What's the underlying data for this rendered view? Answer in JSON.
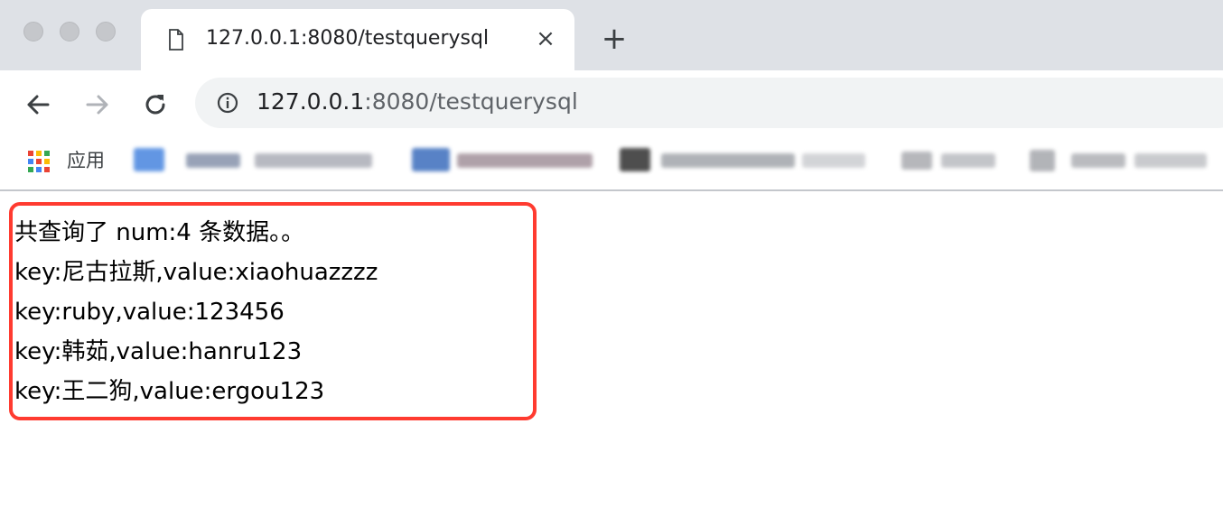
{
  "browser": {
    "tab": {
      "title": "127.0.0.1:8080/testquerysql",
      "close_label": "×"
    },
    "new_tab_label": "+",
    "address_bar": {
      "host": "127.0.0.1",
      "rest": ":8080/testquerysql"
    },
    "bookmarks": {
      "apps_label": "应用"
    }
  },
  "page": {
    "lines": [
      "共查询了 num:4 条数据。。",
      "key:尼古拉斯,value:xiaohuazzzz",
      "key:ruby,value:123456",
      "key:韩茹,value:hanru123",
      "key:王二狗,value:ergou123"
    ]
  },
  "colors": {
    "highlight_border": "#ff3b30",
    "tabstrip": "#dee1e6",
    "omnibox": "#f1f3f4"
  }
}
